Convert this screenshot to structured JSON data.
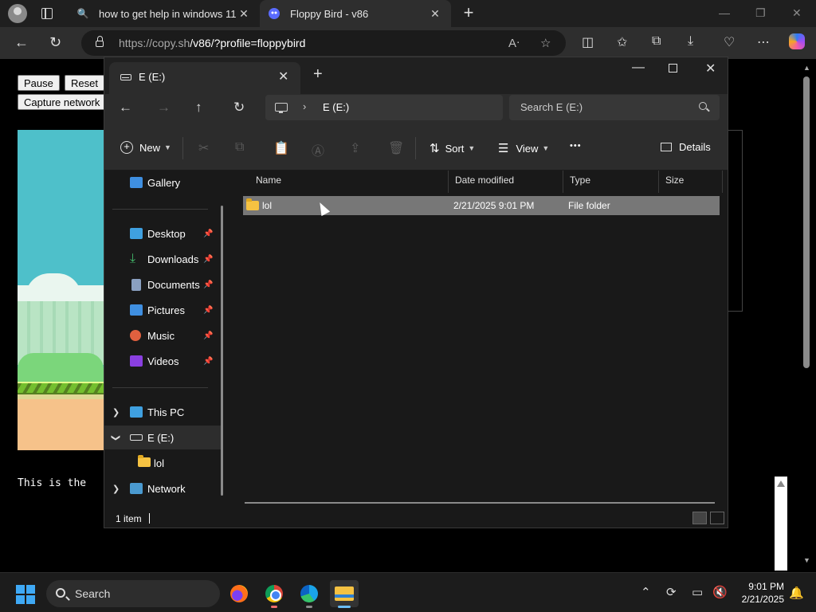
{
  "browser": {
    "tabs": [
      {
        "title": "how to get help in windows 11 -",
        "favicon": "search-icon"
      },
      {
        "title": "Floppy Bird - v86",
        "favicon": "v86-icon"
      }
    ],
    "url_domain": "https://copy.sh",
    "url_path": "/v86/?profile=floppybird",
    "glyphs": {
      "close": "✕",
      "plus": "+",
      "back": "←",
      "reload": "↻",
      "read": "Aᐧ",
      "star": "☆",
      "split": "◫",
      "favs": "✩",
      "collections": "⧉",
      "download": "⤓",
      "heart": "♡",
      "more": "⋯",
      "minimize": "—",
      "restore": "❐"
    }
  },
  "page": {
    "buttons": {
      "pause": "Pause",
      "reset": "Reset",
      "capture": "Capture network"
    },
    "terminal_text": "This is the"
  },
  "explorer": {
    "tab_label": "E (E:)",
    "location": "E (E:)",
    "search_placeholder": "Search E (E:)",
    "commands": {
      "new": "New",
      "sort": "Sort",
      "view": "View",
      "details": "Details",
      "more": "•••"
    },
    "sidebar": {
      "gallery": "Gallery",
      "pinned": [
        {
          "label": "Desktop",
          "icon": "desktop-icon",
          "color": "#3fa0e0"
        },
        {
          "label": "Downloads",
          "icon": "download-icon",
          "color": "#43b86a"
        },
        {
          "label": "Documents",
          "icon": "document-icon",
          "color": "#8aa0c0"
        },
        {
          "label": "Pictures",
          "icon": "pictures-icon",
          "color": "#3f8fe0"
        },
        {
          "label": "Music",
          "icon": "music-icon",
          "color": "#e0603f"
        },
        {
          "label": "Videos",
          "icon": "videos-icon",
          "color": "#8a3fe0"
        }
      ],
      "this_pc": "This PC",
      "drive": "E (E:)",
      "folder": "lol",
      "network": "Network"
    },
    "columns": {
      "name": "Name",
      "date": "Date modified",
      "type": "Type",
      "size": "Size"
    },
    "rows": [
      {
        "name": "lol",
        "date": "2/21/2025 9:01 PM",
        "type": "File folder",
        "size": ""
      }
    ],
    "status": "1 item"
  },
  "taskbar": {
    "search_label": "Search",
    "time": "9:01 PM",
    "date": "2/21/2025"
  }
}
